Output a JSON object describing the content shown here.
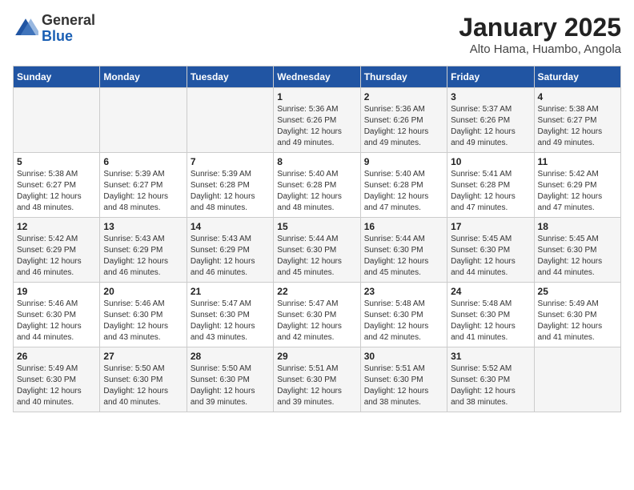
{
  "header": {
    "logo_general": "General",
    "logo_blue": "Blue",
    "month_title": "January 2025",
    "location": "Alto Hama, Huambo, Angola"
  },
  "weekdays": [
    "Sunday",
    "Monday",
    "Tuesday",
    "Wednesday",
    "Thursday",
    "Friday",
    "Saturday"
  ],
  "weeks": [
    [
      {
        "day": "",
        "info": ""
      },
      {
        "day": "",
        "info": ""
      },
      {
        "day": "",
        "info": ""
      },
      {
        "day": "1",
        "info": "Sunrise: 5:36 AM\nSunset: 6:26 PM\nDaylight: 12 hours\nand 49 minutes."
      },
      {
        "day": "2",
        "info": "Sunrise: 5:36 AM\nSunset: 6:26 PM\nDaylight: 12 hours\nand 49 minutes."
      },
      {
        "day": "3",
        "info": "Sunrise: 5:37 AM\nSunset: 6:26 PM\nDaylight: 12 hours\nand 49 minutes."
      },
      {
        "day": "4",
        "info": "Sunrise: 5:38 AM\nSunset: 6:27 PM\nDaylight: 12 hours\nand 49 minutes."
      }
    ],
    [
      {
        "day": "5",
        "info": "Sunrise: 5:38 AM\nSunset: 6:27 PM\nDaylight: 12 hours\nand 48 minutes."
      },
      {
        "day": "6",
        "info": "Sunrise: 5:39 AM\nSunset: 6:27 PM\nDaylight: 12 hours\nand 48 minutes."
      },
      {
        "day": "7",
        "info": "Sunrise: 5:39 AM\nSunset: 6:28 PM\nDaylight: 12 hours\nand 48 minutes."
      },
      {
        "day": "8",
        "info": "Sunrise: 5:40 AM\nSunset: 6:28 PM\nDaylight: 12 hours\nand 48 minutes."
      },
      {
        "day": "9",
        "info": "Sunrise: 5:40 AM\nSunset: 6:28 PM\nDaylight: 12 hours\nand 47 minutes."
      },
      {
        "day": "10",
        "info": "Sunrise: 5:41 AM\nSunset: 6:28 PM\nDaylight: 12 hours\nand 47 minutes."
      },
      {
        "day": "11",
        "info": "Sunrise: 5:42 AM\nSunset: 6:29 PM\nDaylight: 12 hours\nand 47 minutes."
      }
    ],
    [
      {
        "day": "12",
        "info": "Sunrise: 5:42 AM\nSunset: 6:29 PM\nDaylight: 12 hours\nand 46 minutes."
      },
      {
        "day": "13",
        "info": "Sunrise: 5:43 AM\nSunset: 6:29 PM\nDaylight: 12 hours\nand 46 minutes."
      },
      {
        "day": "14",
        "info": "Sunrise: 5:43 AM\nSunset: 6:29 PM\nDaylight: 12 hours\nand 46 minutes."
      },
      {
        "day": "15",
        "info": "Sunrise: 5:44 AM\nSunset: 6:30 PM\nDaylight: 12 hours\nand 45 minutes."
      },
      {
        "day": "16",
        "info": "Sunrise: 5:44 AM\nSunset: 6:30 PM\nDaylight: 12 hours\nand 45 minutes."
      },
      {
        "day": "17",
        "info": "Sunrise: 5:45 AM\nSunset: 6:30 PM\nDaylight: 12 hours\nand 44 minutes."
      },
      {
        "day": "18",
        "info": "Sunrise: 5:45 AM\nSunset: 6:30 PM\nDaylight: 12 hours\nand 44 minutes."
      }
    ],
    [
      {
        "day": "19",
        "info": "Sunrise: 5:46 AM\nSunset: 6:30 PM\nDaylight: 12 hours\nand 44 minutes."
      },
      {
        "day": "20",
        "info": "Sunrise: 5:46 AM\nSunset: 6:30 PM\nDaylight: 12 hours\nand 43 minutes."
      },
      {
        "day": "21",
        "info": "Sunrise: 5:47 AM\nSunset: 6:30 PM\nDaylight: 12 hours\nand 43 minutes."
      },
      {
        "day": "22",
        "info": "Sunrise: 5:47 AM\nSunset: 6:30 PM\nDaylight: 12 hours\nand 42 minutes."
      },
      {
        "day": "23",
        "info": "Sunrise: 5:48 AM\nSunset: 6:30 PM\nDaylight: 12 hours\nand 42 minutes."
      },
      {
        "day": "24",
        "info": "Sunrise: 5:48 AM\nSunset: 6:30 PM\nDaylight: 12 hours\nand 41 minutes."
      },
      {
        "day": "25",
        "info": "Sunrise: 5:49 AM\nSunset: 6:30 PM\nDaylight: 12 hours\nand 41 minutes."
      }
    ],
    [
      {
        "day": "26",
        "info": "Sunrise: 5:49 AM\nSunset: 6:30 PM\nDaylight: 12 hours\nand 40 minutes."
      },
      {
        "day": "27",
        "info": "Sunrise: 5:50 AM\nSunset: 6:30 PM\nDaylight: 12 hours\nand 40 minutes."
      },
      {
        "day": "28",
        "info": "Sunrise: 5:50 AM\nSunset: 6:30 PM\nDaylight: 12 hours\nand 39 minutes."
      },
      {
        "day": "29",
        "info": "Sunrise: 5:51 AM\nSunset: 6:30 PM\nDaylight: 12 hours\nand 39 minutes."
      },
      {
        "day": "30",
        "info": "Sunrise: 5:51 AM\nSunset: 6:30 PM\nDaylight: 12 hours\nand 38 minutes."
      },
      {
        "day": "31",
        "info": "Sunrise: 5:52 AM\nSunset: 6:30 PM\nDaylight: 12 hours\nand 38 minutes."
      },
      {
        "day": "",
        "info": ""
      }
    ]
  ]
}
